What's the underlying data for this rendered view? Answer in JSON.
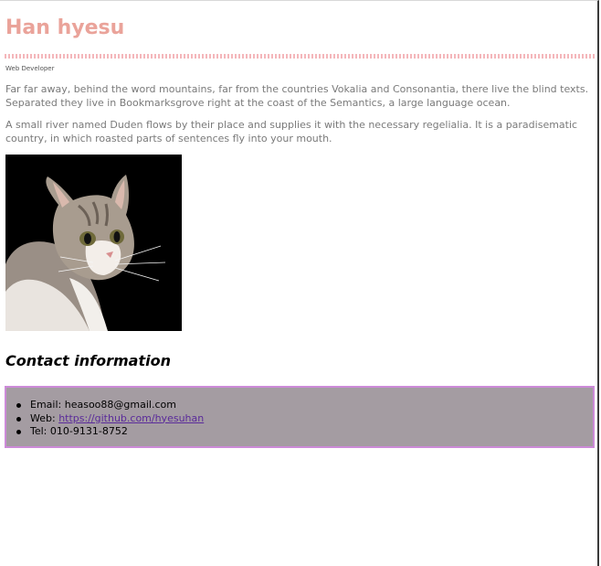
{
  "header": {
    "title": "Han hyesu",
    "subtitle": "Web Developer"
  },
  "intro": {
    "paragraph_1": "Far far away, behind the word mountains, far from the countries Vokalia and Consonantia, there live the blind texts. Separated they live in Bookmarksgrove right at the coast of the Semantics, a large language ocean.",
    "paragraph_2": "A small river named Duden flows by their place and supplies it with the necessary regelialia. It is a paradisematic country, in which roasted parts of sentences fly into your mouth."
  },
  "contact": {
    "heading": "Contact information",
    "email_label": "Email: ",
    "email_value": "heasoo88@gmail.com",
    "web_label": "Web: ",
    "web_link": "https://github.com/hyesuhan",
    "tel_label": "Tel: ",
    "tel_value": "010-9131-8752"
  },
  "colors": {
    "title": "#eaa39a",
    "divider": "#f4b7bb",
    "contact_bg": "#a49ca2",
    "contact_border": "#cc8bd8",
    "link": "#5a2a9a"
  }
}
